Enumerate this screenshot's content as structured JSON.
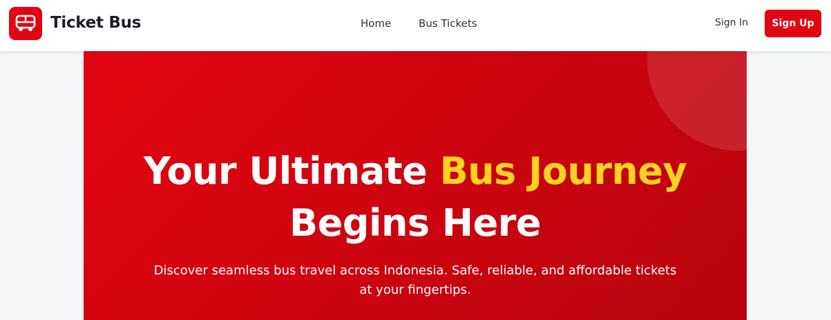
{
  "header": {
    "brand": "Ticket Bus",
    "logo_icon": "bus-icon",
    "nav": {
      "home": "Home",
      "bus_tickets": "Bus Tickets"
    },
    "sign_in": "Sign In",
    "sign_up": "Sign Up"
  },
  "hero": {
    "title_part1": "Your Ultimate ",
    "title_accent": "Bus Journey",
    "title_part2": "Begins Here",
    "subtitle": "Discover seamless bus travel across Indonesia. Safe, reliable, and affordable tickets at your fingertips."
  },
  "colors": {
    "brand_red": "#e10613",
    "accent_yellow": "#ffd21f",
    "text_dark": "#1a1f2b"
  }
}
